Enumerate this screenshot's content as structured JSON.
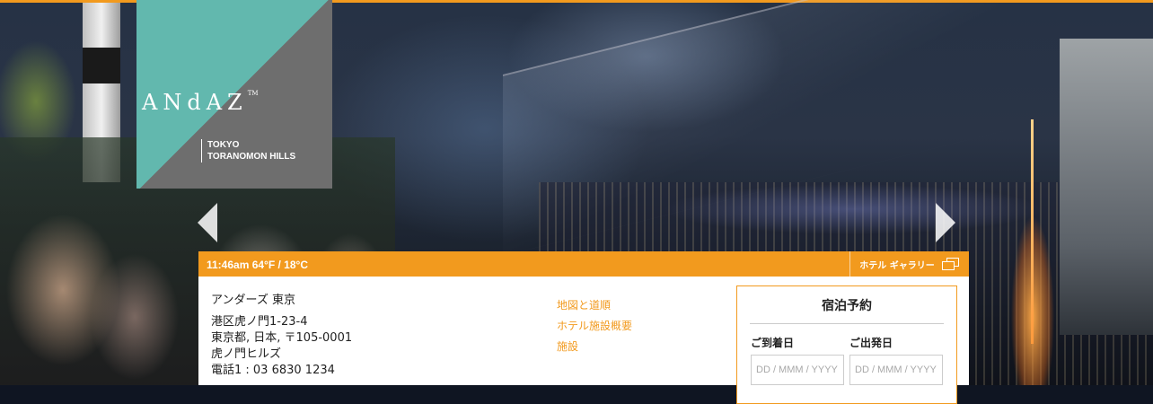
{
  "brand": {
    "logo_text": "ANdAZ",
    "tm": "TM",
    "subtitle_line1": "TOKYO",
    "subtitle_line2": "TORANOMON HILLS"
  },
  "info_bar": {
    "weather": "11:46am  64°F / 18°C",
    "gallery_label": "ホテル ギャラリー"
  },
  "address": {
    "name": "アンダーズ 東京",
    "line1": "港区虎ノ門1-23-4",
    "line2": "東京都, 日本, 〒105-0001",
    "line3": "虎ノ門ヒルズ",
    "phone1": "電話1 : 03 6830 1234"
  },
  "links": [
    "地図と道順",
    "ホテル施設概要",
    "施設"
  ],
  "booking": {
    "title": "宿泊予約",
    "checkin_label": "ご到着日",
    "checkout_label": "ご出発日",
    "date_placeholder": "DD / MMM / YYYY"
  },
  "colors": {
    "accent": "#f29a1e",
    "logo_teal": "#62b8ae",
    "logo_gray": "#6e6e6e"
  }
}
